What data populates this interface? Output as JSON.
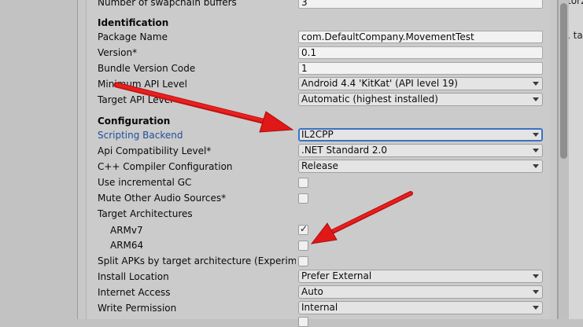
{
  "rows": {
    "swapchain": {
      "label": "Number of swapchain buffers",
      "value": "3"
    },
    "identification_header": "Identification",
    "package_name": {
      "label": "Package Name",
      "value": "com.DefaultCompany.MovementTest"
    },
    "version": {
      "label": "Version*",
      "value": "0.1"
    },
    "bundle_version": {
      "label": "Bundle Version Code",
      "value": "1"
    },
    "min_api": {
      "label": "Minimum API Level",
      "value": "Android 4.4 'KitKat' (API level 19)"
    },
    "target_api": {
      "label": "Target API Level",
      "value": "Automatic (highest installed)"
    },
    "configuration_header": "Configuration",
    "scripting_backend": {
      "label": "Scripting Backend",
      "value": "IL2CPP"
    },
    "api_compat": {
      "label": "Api Compatibility Level*",
      "value": ".NET Standard 2.0"
    },
    "cpp_compiler": {
      "label": "C++ Compiler Configuration",
      "value": "Release"
    },
    "incremental_gc": {
      "label": "Use incremental GC",
      "checked": false
    },
    "mute_audio": {
      "label": "Mute Other Audio Sources*",
      "checked": false
    },
    "target_arch": {
      "label": "Target Architectures"
    },
    "armv7": {
      "label": "ARMv7",
      "checked": true,
      "mark": "✓"
    },
    "arm64": {
      "label": "ARM64",
      "checked": false
    },
    "split_apks": {
      "label": "Split APKs by target architecture (Experimental)",
      "checked": false
    },
    "install_location": {
      "label": "Install Location",
      "value": "Prefer External"
    },
    "internet_access": {
      "label": "Internet Access",
      "value": "Auto"
    },
    "write_permission": {
      "label": "Write Permission",
      "value": "Internal"
    }
  },
  "right_panel": {
    "frag1": "tor2",
    "frag2": ", tar"
  },
  "colors": {
    "annotation_arrow": "#e01818",
    "link_label": "#1f4f9c"
  }
}
